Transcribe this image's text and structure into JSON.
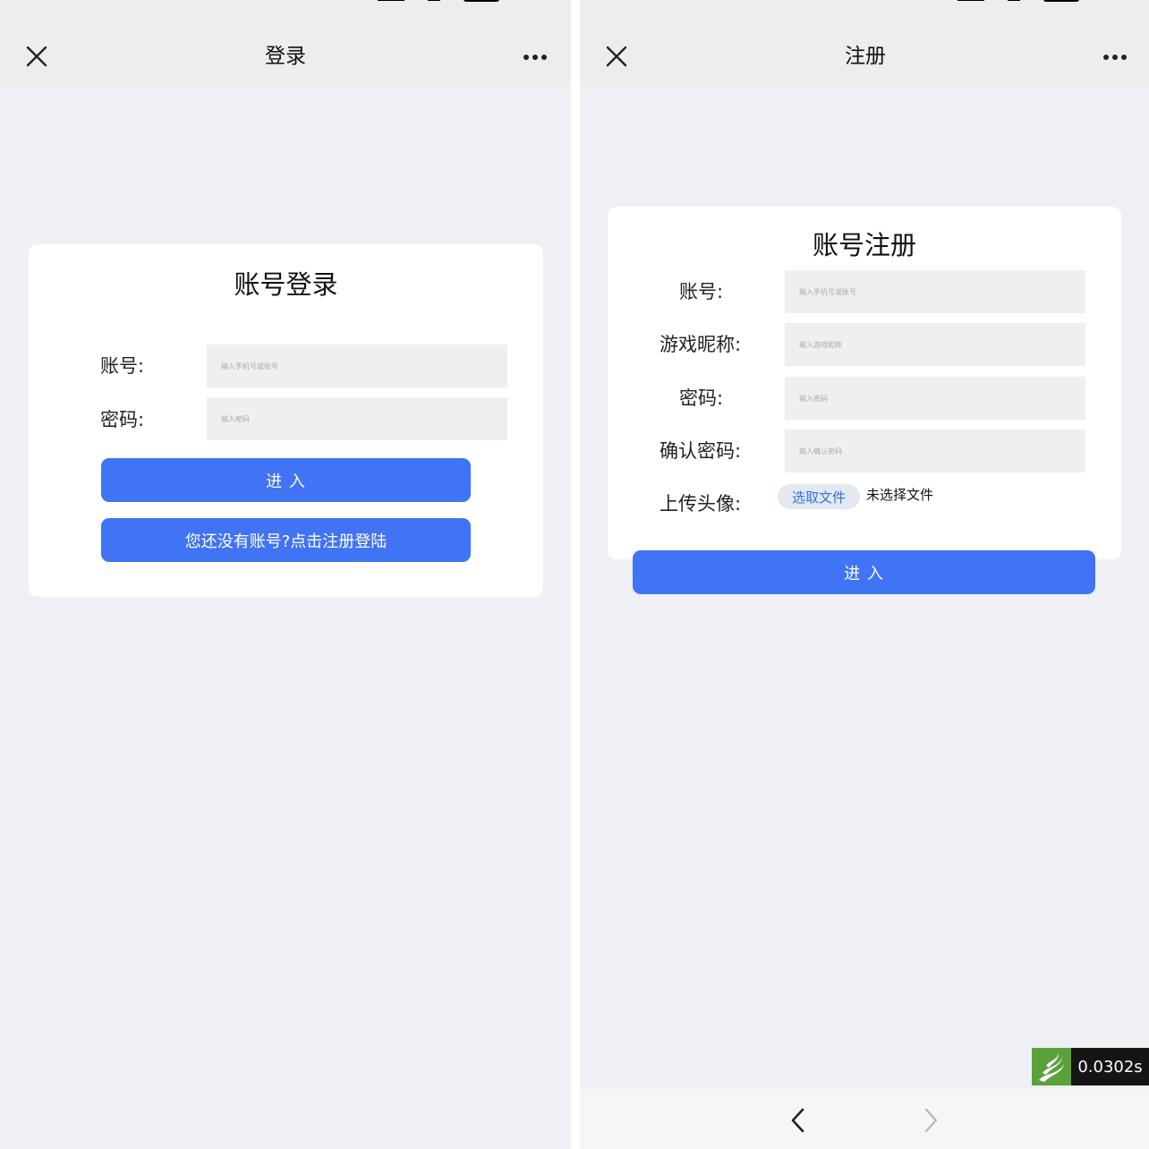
{
  "login": {
    "nav_title": "登录",
    "card_title": "账号登录",
    "account_label": "账号:",
    "account_placeholder": "输入手机号或账号",
    "password_label": "密码:",
    "password_placeholder": "输入密码",
    "enter_button": "进 入",
    "register_link_button": "您还没有账号?点击注册登陆"
  },
  "register": {
    "nav_title": "注册",
    "card_title": "账号注册",
    "account_label": "账号:",
    "account_placeholder": "输入手机号或账号",
    "nickname_label": "游戏昵称:",
    "nickname_placeholder": "输入游戏昵称",
    "password_label": "密码:",
    "password_placeholder": "输入密码",
    "confirm_label": "确认密码:",
    "confirm_placeholder": "输入确认密码",
    "avatar_label": "上传头像:",
    "file_button": "选取文件",
    "file_status": "未选择文件",
    "enter_button": "进 入"
  },
  "timer_badge": {
    "value": "0.0302s"
  },
  "icons": {
    "close": "close-icon",
    "more": "more-icon",
    "back": "chevron-left-icon",
    "forward": "chevron-right-icon",
    "timer_logo": "flame-logo-icon"
  },
  "colors": {
    "primary_button": "#4173f5",
    "page_bg": "#eff0f5",
    "navbar_bg": "#ededed",
    "input_bg": "#efefef",
    "file_button_text": "#2f74d9"
  }
}
